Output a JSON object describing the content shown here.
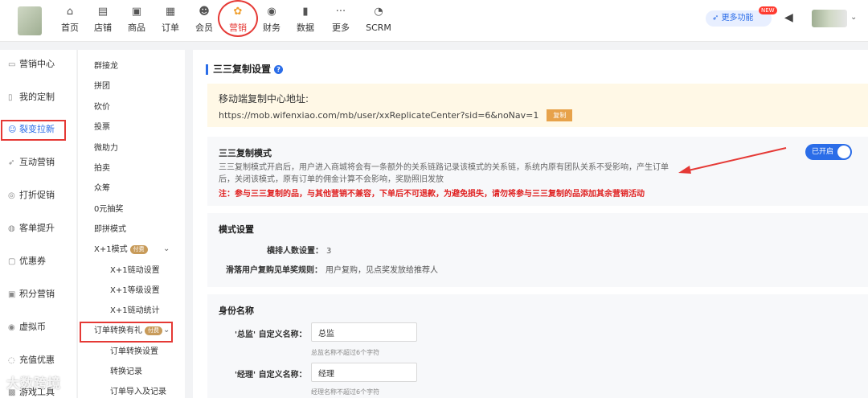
{
  "topnav": {
    "items": [
      {
        "label": "首页",
        "icon": "home-icon",
        "glyph": "⌂"
      },
      {
        "label": "店铺",
        "icon": "store-icon",
        "glyph": "▤"
      },
      {
        "label": "商品",
        "icon": "goods-icon",
        "glyph": "▣"
      },
      {
        "label": "订单",
        "icon": "order-icon",
        "glyph": "▦"
      },
      {
        "label": "会员",
        "icon": "member-icon",
        "glyph": "☻"
      },
      {
        "label": "营销",
        "icon": "marketing-icon",
        "glyph": "✿"
      },
      {
        "label": "财务",
        "icon": "finance-icon",
        "glyph": "◉"
      },
      {
        "label": "数据",
        "icon": "data-icon",
        "glyph": "▮"
      },
      {
        "label": "更多",
        "icon": "more-icon",
        "glyph": "···"
      },
      {
        "label": "SCRM",
        "icon": "scrm-icon",
        "glyph": "◔"
      }
    ],
    "more_features": "更多功能",
    "new_badge": "NEW"
  },
  "sidebar": {
    "items": [
      {
        "label": "营销中心",
        "glyph": "▭"
      },
      {
        "label": "我的定制",
        "glyph": "▯"
      },
      {
        "label": "裂变拉新",
        "glyph": "☺"
      },
      {
        "label": "互动营销",
        "glyph": "➶"
      },
      {
        "label": "打折促销",
        "glyph": "◎"
      },
      {
        "label": "客单提升",
        "glyph": "◍"
      },
      {
        "label": "优惠券",
        "glyph": "▢"
      },
      {
        "label": "积分营销",
        "glyph": "▣"
      },
      {
        "label": "虚拟币",
        "glyph": "◉"
      },
      {
        "label": "充值优惠",
        "glyph": "◌"
      },
      {
        "label": "游戏工具",
        "glyph": "▩"
      }
    ]
  },
  "subnav": {
    "items": [
      "群接龙",
      "拼团",
      "砍价",
      "投票",
      "微助力",
      "拍卖",
      "众筹",
      "0元抽奖",
      "即拼模式"
    ],
    "x1_mode": "X+1模式",
    "x1_children": [
      "X+1链动设置",
      "X+1等级设置",
      "X+1链动统计"
    ],
    "order_gift": "订单转换有礼",
    "order_children": [
      "订单转换设置",
      "转换记录",
      "订单导入及记录"
    ],
    "paid_badge": "付费"
  },
  "main": {
    "section_title": "三三复制设置",
    "address_label": "移动端复制中心地址:",
    "address_url": "https://mob.wifenxiao.com/mb/user/xxReplicateCenter?sid=6&noNav=1",
    "copy_button": "复制",
    "mode_title": "三三复制模式",
    "mode_desc": "三三复制模式开启后，用户进入商城将会有一条额外的关系链路记录该模式的关系链，系统内原有团队关系不受影响，产生订单后，关闭该模式，原有订单的佣金计算不会影响，奖励照旧发放",
    "mode_warning": "注：参与三三复制的品，与其他营销不兼容，下单后不可退款，为避免损失，请勿将参与三三复制的品添加其余营销活动",
    "toggle_label": "已开启",
    "pattern_title": "模式设置",
    "rank_label": "横排人数设置：",
    "rank_value": "3",
    "slide_label": "滑落用户复购见单奖规则：",
    "slide_value": "用户复购，见点奖发放给推荐人",
    "identity_title": "身份名称",
    "director_label": "'总监' 自定义名称：",
    "director_value": "总监",
    "director_hint": "总监名称不超过6个字符",
    "manager_label": "'经理' 自定义名称：",
    "manager_value": "经理",
    "manager_hint": "经理名称不超过6个字符"
  },
  "watermark": "大数跨境",
  "colors": {
    "accent": "#2b6de8",
    "alert": "#e53935",
    "notice_bg": "#fff8e6",
    "copy_button": "#e7a24a"
  }
}
